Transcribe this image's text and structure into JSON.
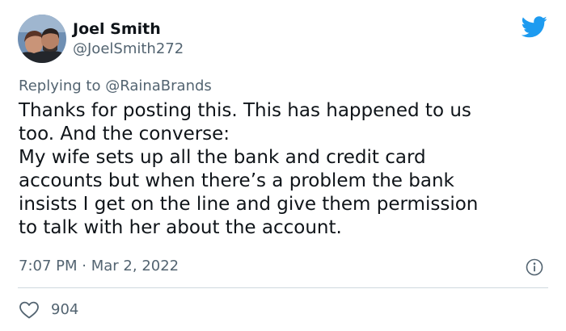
{
  "author": {
    "display_name": "Joel Smith",
    "handle": "@JoelSmith272",
    "avatar_icon": "profile-photo-avatar"
  },
  "brand": {
    "logo_icon": "twitter-bird-icon",
    "color": "#1d9bf0"
  },
  "reply": {
    "prefix": "Replying to",
    "mention": "@RainaBrands"
  },
  "tweet_text": {
    "lines": [
      "Thanks for posting this. This has happened to us",
      "too. And the converse:",
      "My wife sets up all the bank and credit card",
      "accounts but when there’s a problem the bank",
      "insists I get on the line and give them permission",
      "to talk with her about the account."
    ]
  },
  "meta": {
    "time": "7:07 PM",
    "separator": "·",
    "date": "Mar 2, 2022",
    "info_icon": "info-icon"
  },
  "actions": {
    "like_icon": "heart-icon",
    "like_count": "904"
  },
  "colors": {
    "text_primary": "#0f1419",
    "text_secondary": "#536471",
    "divider": "#cfd9de"
  }
}
